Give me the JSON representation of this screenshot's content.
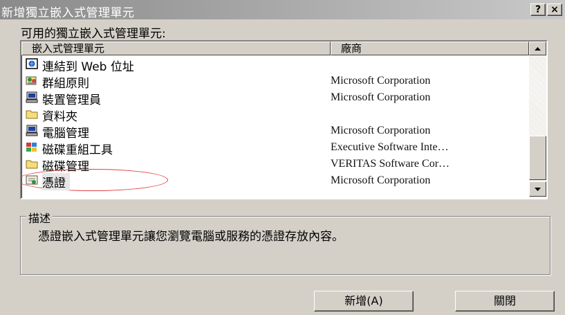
{
  "window": {
    "title": "新增獨立嵌入式管理單元",
    "help_label": "?",
    "close_label": "×"
  },
  "available_label": "可用的獨立嵌入式管理單元:",
  "list": {
    "columns": [
      "嵌入式管理單元",
      "廠商"
    ],
    "rows": [
      {
        "name": "連結到 Web 位址",
        "vendor": "",
        "icon": "web-link-icon"
      },
      {
        "name": "群組原則",
        "vendor": "Microsoft Corporation",
        "icon": "group-policy-icon"
      },
      {
        "name": "裝置管理員",
        "vendor": "Microsoft Corporation",
        "icon": "computer-icon"
      },
      {
        "name": "資料夾",
        "vendor": "",
        "icon": "folder-icon"
      },
      {
        "name": "電腦管理",
        "vendor": "Microsoft Corporation",
        "icon": "computer-icon"
      },
      {
        "name": "磁碟重組工具",
        "vendor": "Executive Software Inte…",
        "icon": "defrag-icon"
      },
      {
        "name": "磁碟管理",
        "vendor": "VERITAS Software Cor…",
        "icon": "folder-icon"
      },
      {
        "name": "憑證",
        "vendor": "Microsoft Corporation",
        "icon": "certificate-icon"
      }
    ],
    "selected_index": 7
  },
  "description": {
    "title": "描述",
    "text": "憑證嵌入式管理單元讓您瀏覽電腦或服務的憑證存放內容。"
  },
  "buttons": {
    "add": "新增(A)",
    "close": "關閉"
  },
  "colors": {
    "face": "#d4d0c8",
    "title_gradient_start": "#8a8a8a",
    "title_gradient_end": "#c9c9c9",
    "annotation_oval": "#e03c3c"
  }
}
